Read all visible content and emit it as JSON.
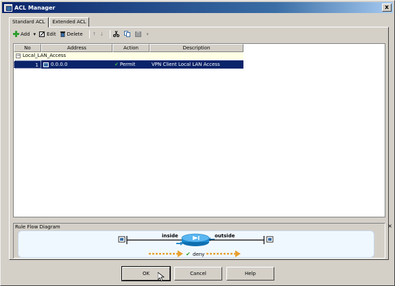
{
  "window": {
    "title": "ACL Manager",
    "close_label": "x"
  },
  "tabs": [
    {
      "label": "Standard ACL"
    },
    {
      "label": "Extended ACL"
    }
  ],
  "toolbar": {
    "add_label": "Add",
    "edit_label": "Edit",
    "delete_label": "Delete",
    "dropdown_arrow": "▾",
    "move_up_glyph": "↑",
    "move_down_glyph": "↓"
  },
  "table": {
    "columns": [
      {
        "label": "No"
      },
      {
        "label": "Address"
      },
      {
        "label": "Action"
      },
      {
        "label": "Description"
      }
    ],
    "group": {
      "name": "Local_LAN_Access",
      "expander": "−"
    },
    "rows": [
      {
        "no": "1",
        "address": "0.0.0.0",
        "action": "Permit",
        "description": "VPN Client Local LAN Access"
      }
    ]
  },
  "rule_flow": {
    "title": "Rule Flow Diagram",
    "close_label": "×",
    "inside_label": "inside",
    "outside_label": "outside",
    "deny_label": "deny"
  },
  "buttons": {
    "ok_label": "OK",
    "cancel_label": "Cancel",
    "help_label": "Help"
  },
  "colors": {
    "selection": "#0a246a",
    "group_row": "#ffffe6",
    "flow_arrow": "#e8a030",
    "router": "#1a8fd8"
  }
}
